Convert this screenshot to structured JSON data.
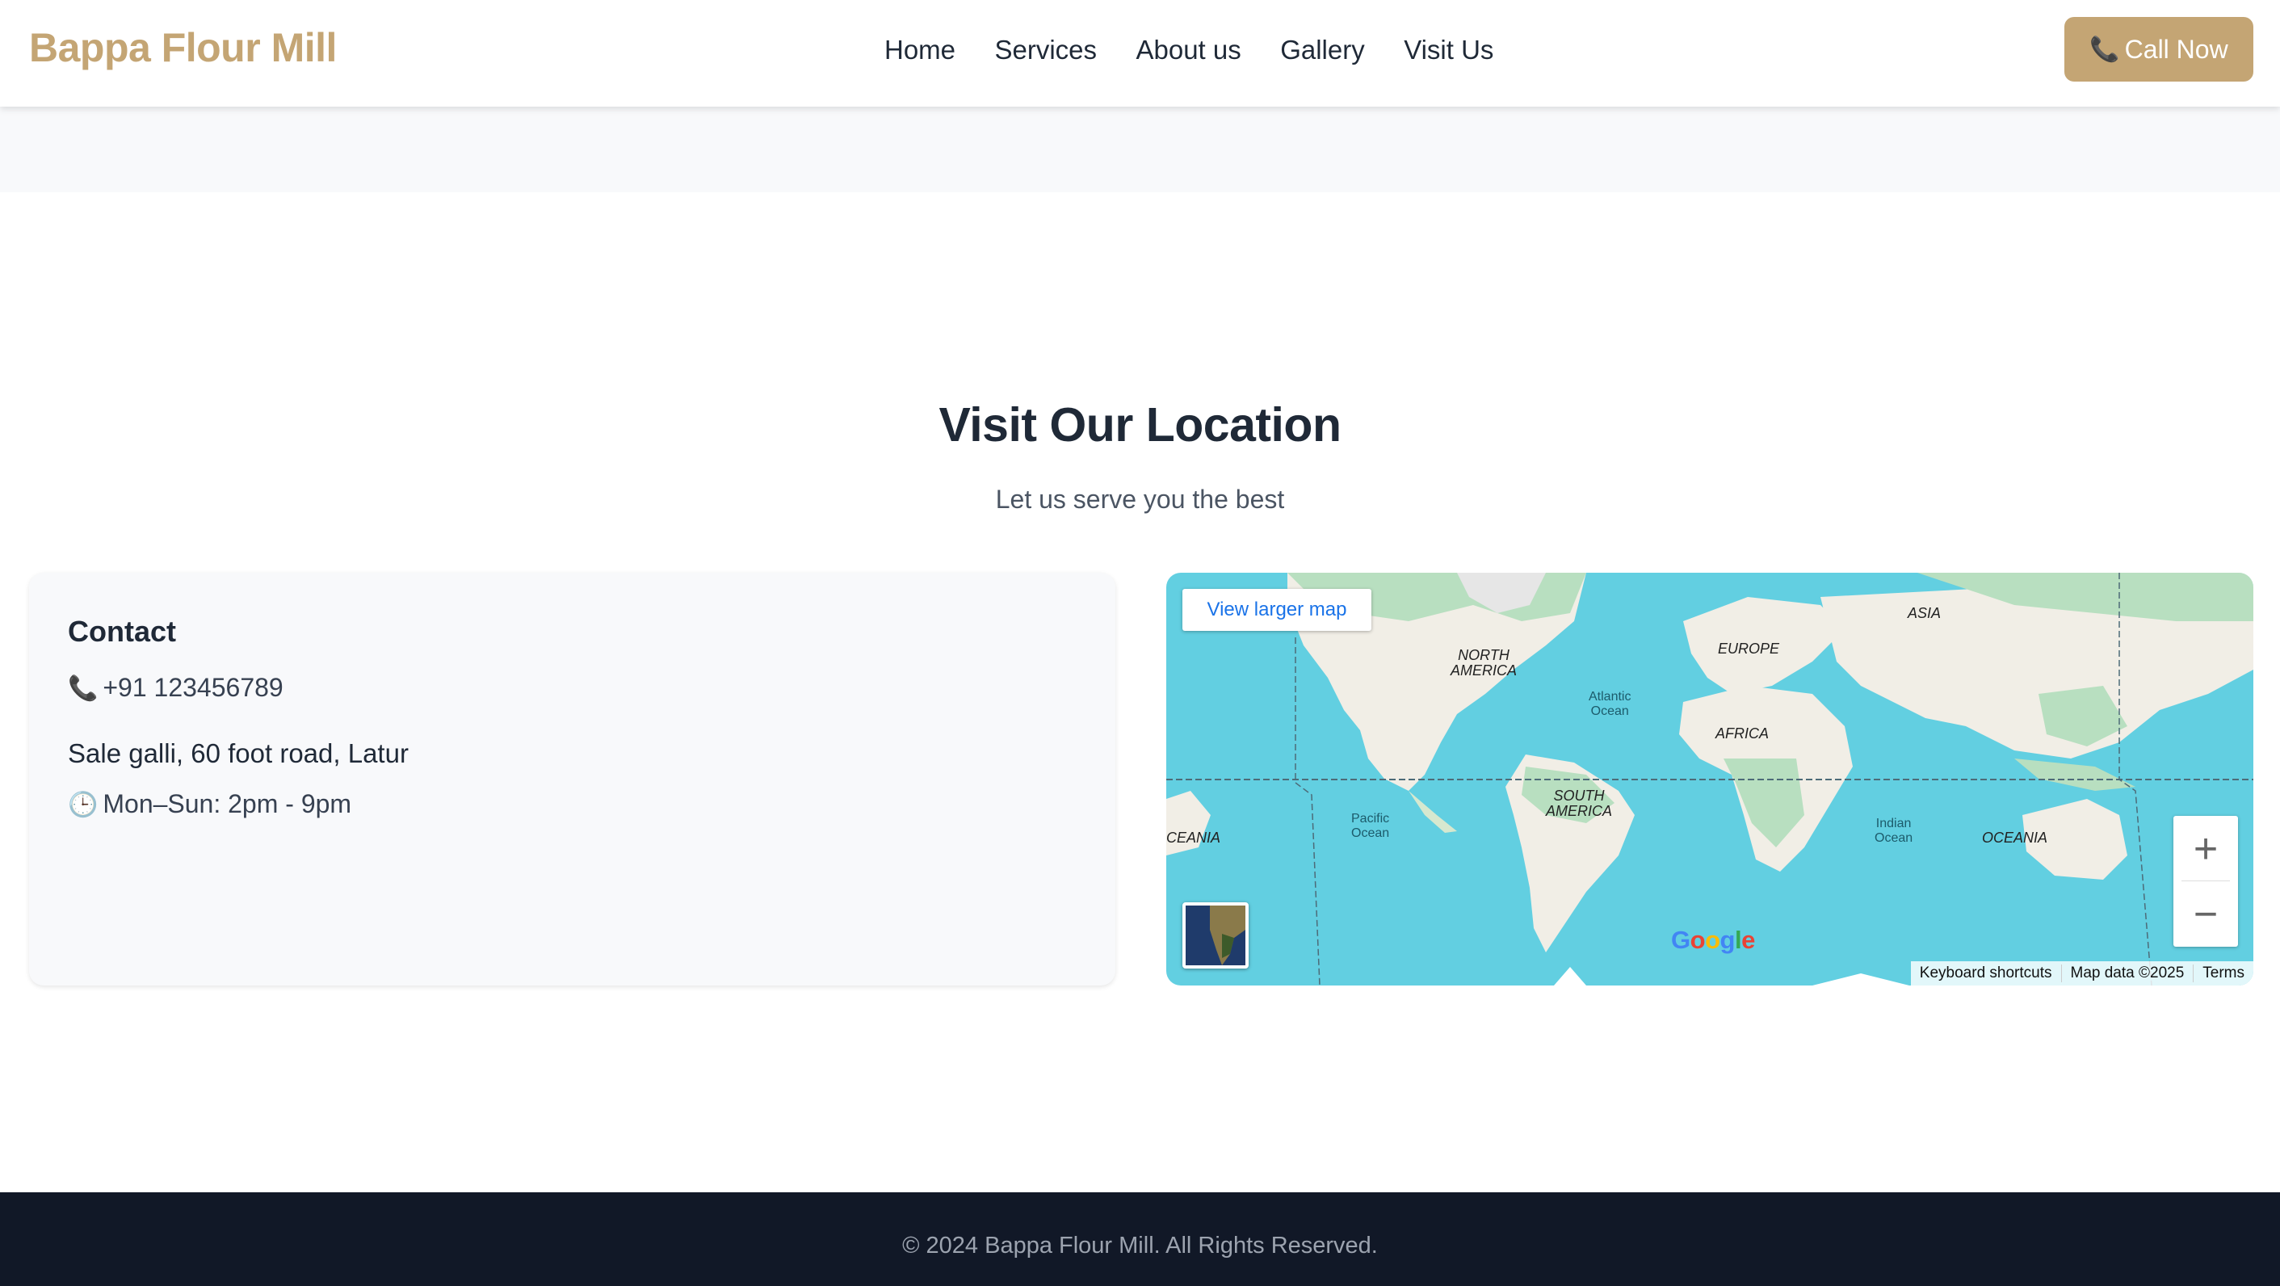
{
  "header": {
    "logo": "Bappa Flour Mill",
    "nav": [
      "Home",
      "Services",
      "About us",
      "Gallery",
      "Visit Us"
    ],
    "call_label": "Call Now"
  },
  "section": {
    "title": "Visit Our Location",
    "subtitle": "Let us serve you the best"
  },
  "contact": {
    "heading": "Contact",
    "phone": "+91 123456789",
    "address": "Sale galli, 60 foot road, Latur",
    "hours": "Mon–Sun: 2pm - 9pm"
  },
  "map": {
    "view_larger": "View larger map",
    "labels": {
      "north_america": [
        "NORTH",
        "AMERICA"
      ],
      "south_america": [
        "SOUTH",
        "AMERICA"
      ],
      "europe": "EUROPE",
      "asia": "ASIA",
      "africa": "AFRICA",
      "oceania": "OCEANIA",
      "oceania_left": "CEANIA",
      "atlantic": [
        "Atlantic",
        "Ocean"
      ],
      "pacific": [
        "Pacific",
        "Ocean"
      ],
      "indian": [
        "Indian",
        "Ocean"
      ]
    },
    "google": "Google",
    "attribution": [
      "Keyboard shortcuts",
      "Map data ©2025",
      "Terms"
    ]
  },
  "footer": {
    "copyright": "© 2024 Bappa Flour Mill. All Rights Reserved."
  },
  "colors": {
    "brand": "#c4a574",
    "footer_bg": "#111827",
    "ocean": "#62cfe1",
    "land": "#f1eee6",
    "land_green": "#b8dfc0"
  },
  "icons": {
    "phone": "phone-icon",
    "clock": "clock-icon"
  }
}
